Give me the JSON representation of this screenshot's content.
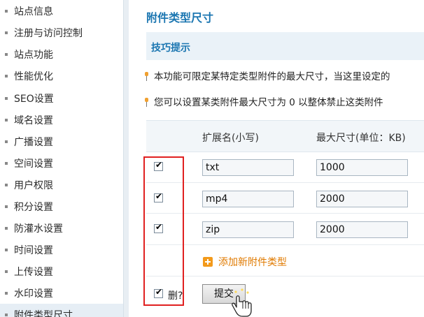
{
  "sidebar": {
    "items": [
      {
        "label": "站点信息",
        "active": false
      },
      {
        "label": "注册与访问控制",
        "active": false
      },
      {
        "label": "站点功能",
        "active": false
      },
      {
        "label": "性能优化",
        "active": false
      },
      {
        "label": "SEO设置",
        "active": false
      },
      {
        "label": "域名设置",
        "active": false
      },
      {
        "label": "广播设置",
        "active": false
      },
      {
        "label": "空间设置",
        "active": false
      },
      {
        "label": "用户权限",
        "active": false
      },
      {
        "label": "积分设置",
        "active": false
      },
      {
        "label": "防灌水设置",
        "active": false
      },
      {
        "label": "时间设置",
        "active": false
      },
      {
        "label": "上传设置",
        "active": false
      },
      {
        "label": "水印设置",
        "active": false
      },
      {
        "label": "附件类型尺寸",
        "active": true
      }
    ]
  },
  "main": {
    "title": "附件类型尺寸",
    "tips": {
      "title": "技巧提示",
      "items": [
        "本功能可限定某特定类型附件的最大尺寸，当这里设定的",
        "您可以设置某类附件最大尺寸为  0 以整体禁止这类附件"
      ]
    },
    "table": {
      "columns": [
        "扩展名(小写)",
        "最大尺寸(单位：KB)"
      ],
      "rows": [
        {
          "checked": true,
          "ext": "txt",
          "size": "1000"
        },
        {
          "checked": true,
          "ext": "mp4",
          "size": "2000"
        },
        {
          "checked": true,
          "ext": "zip",
          "size": "2000"
        }
      ]
    },
    "add_label": "添加新附件类型",
    "delete_label": "删?",
    "delete_checked": true,
    "submit_label": "提交"
  },
  "colors": {
    "accent": "#1b76b1",
    "link_orange": "#e07a00",
    "highlight_box": "#e02020"
  }
}
